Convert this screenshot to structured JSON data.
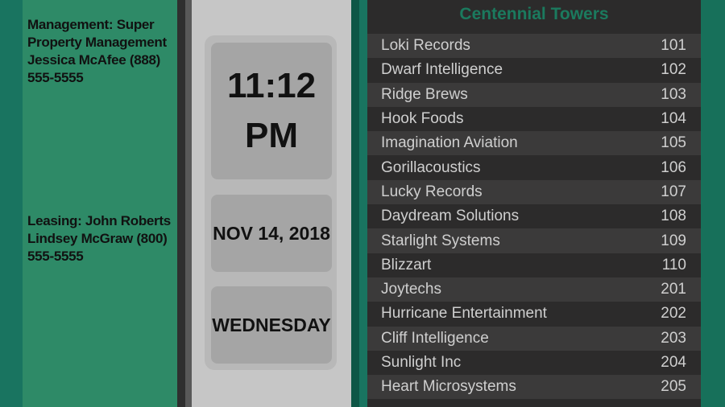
{
  "contacts": {
    "management": "Management: Super Property Management Jessica McAfee (888) 555-5555",
    "leasing": "Leasing: John Roberts Lindsey McGraw (800) 555-5555"
  },
  "clock": {
    "time": "11:12",
    "ampm": "PM",
    "date": "NOV 14, 2018",
    "day": "WEDNESDAY"
  },
  "directory": {
    "title": "Centennial Towers",
    "entries": [
      {
        "name": "Loki Records",
        "suite": "101"
      },
      {
        "name": "Dwarf Intelligence",
        "suite": "102"
      },
      {
        "name": "Ridge Brews",
        "suite": "103"
      },
      {
        "name": "Hook Foods",
        "suite": "104"
      },
      {
        "name": "Imagination Aviation",
        "suite": "105"
      },
      {
        "name": "Gorillacoustics",
        "suite": "106"
      },
      {
        "name": "Lucky Records",
        "suite": "107"
      },
      {
        "name": "Daydream Solutions",
        "suite": "108"
      },
      {
        "name": "Starlight Systems",
        "suite": "109"
      },
      {
        "name": "Blizzart",
        "suite": "110"
      },
      {
        "name": "Joytechs",
        "suite": "201"
      },
      {
        "name": "Hurricane Entertainment",
        "suite": "202"
      },
      {
        "name": "Cliff Intelligence",
        "suite": "203"
      },
      {
        "name": "Sunlight Inc",
        "suite": "204"
      },
      {
        "name": "Heart Microsystems",
        "suite": "205"
      }
    ]
  },
  "colors": {
    "accent": "#1b7a5e",
    "panel_green": "#2e8a67",
    "directory_bg": "#2c2b2b"
  }
}
